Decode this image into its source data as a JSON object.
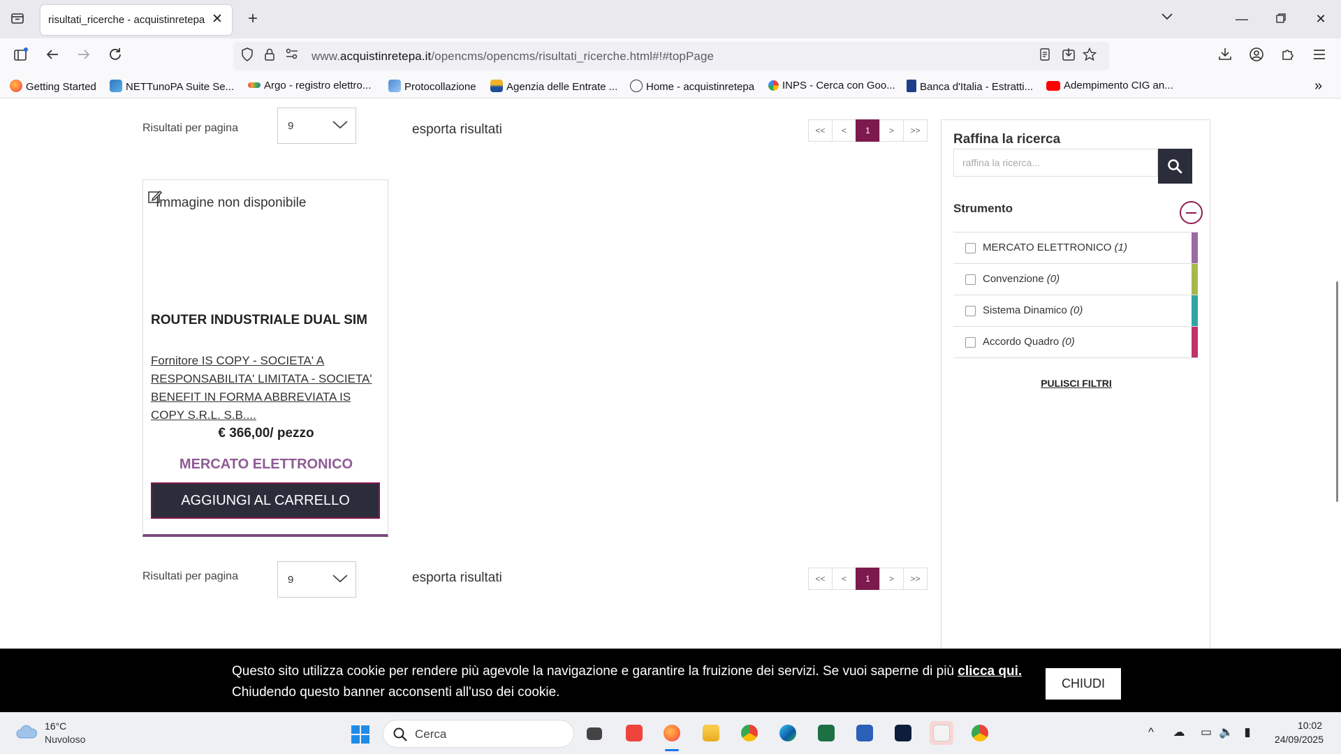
{
  "browser": {
    "tab_title": "risultati_ricerche - acquistinretepa",
    "url_prefix": "www.",
    "url_domain": "acquistinretepa.it",
    "url_path": "/opencms/opencms/risultati_ricerche.html#!#topPage",
    "bookmarks": [
      "Getting Started",
      "NETTunoPA  Suite Se...",
      "Argo - registro elettro...",
      "Protocollazione",
      "Agenzia delle Entrate ...",
      "Home - acquistinretepa",
      "INPS - Cerca con Goo...",
      "Banca d'Italia - Estratti...",
      "Adempimento CIG an..."
    ]
  },
  "toolbar": {
    "rpp_label": "Risultati per pagina",
    "rpp_value": "9",
    "export_label": "esporta risultati",
    "pager": [
      "<<",
      "<",
      "1",
      ">",
      ">>"
    ]
  },
  "product": {
    "image_alt": "Immagine non disponibile",
    "name": "ROUTER INDUSTRIALE DUAL SIM",
    "supplier": "Fornitore IS COPY - SOCIETA' A RESPONSABILITA' LIMITATA - SOCIETA' BENEFIT IN FORMA ABBREVIATA IS COPY S.R.L. S.B....",
    "price": "€ 366,00/ pezzo",
    "tool": "MERCATO ELETTRONICO",
    "add_button": "AGGIUNGI AL CARRELLO"
  },
  "sidebar": {
    "title": "Raffina la ricerca",
    "search_placeholder": "raffina la ricerca...",
    "section_title": "Strumento",
    "filters": [
      {
        "label": "MERCATO ELETTRONICO",
        "count": "(1)",
        "color": "#9a6aa3"
      },
      {
        "label": "Convenzione",
        "count": "(0)",
        "color": "#a8b84c"
      },
      {
        "label": "Sistema Dinamico",
        "count": "(0)",
        "color": "#2fa6a3"
      },
      {
        "label": "Accordo Quadro",
        "count": "(0)",
        "color": "#c0336b"
      }
    ],
    "clear_filters": "PULISCI FILTRI"
  },
  "cookie": {
    "text1": "Questo sito utilizza cookie per rendere più agevole la navigazione e garantire la fruizione dei servizi. Se vuoi saperne di più ",
    "link": "clicca qui.",
    "text2": "Chiudendo questo banner acconsenti all'uso dei cookie.",
    "close": "CHIUDI"
  },
  "taskbar": {
    "weather_temp": "16°C",
    "weather_desc": "Nuvoloso",
    "search_label": "Cerca",
    "time": "10:02",
    "date": "24/09/2025"
  },
  "colors": {
    "accent": "#7d1a4d",
    "button_dark": "#2b2d3a",
    "tool_purple": "#8e5b94"
  }
}
